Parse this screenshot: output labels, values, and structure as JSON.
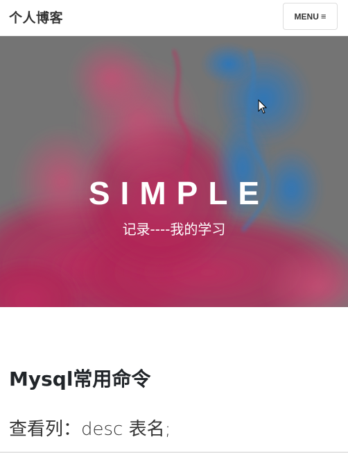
{
  "navbar": {
    "brand": "个人博客",
    "menu_label": "MENU",
    "menu_icon": "hamburger-icon",
    "menu_glyph": "≡"
  },
  "hero": {
    "title": "SIMPLE",
    "subtitle": "记录----我的学习",
    "overlay_color": "#7d7d7d",
    "ink_colors": [
      "#d8336b",
      "#c4245a",
      "#2f86d6",
      "#e8557f"
    ]
  },
  "post": {
    "title": "Mysql常用命令",
    "first_line": "查看列：desc 表名;"
  }
}
